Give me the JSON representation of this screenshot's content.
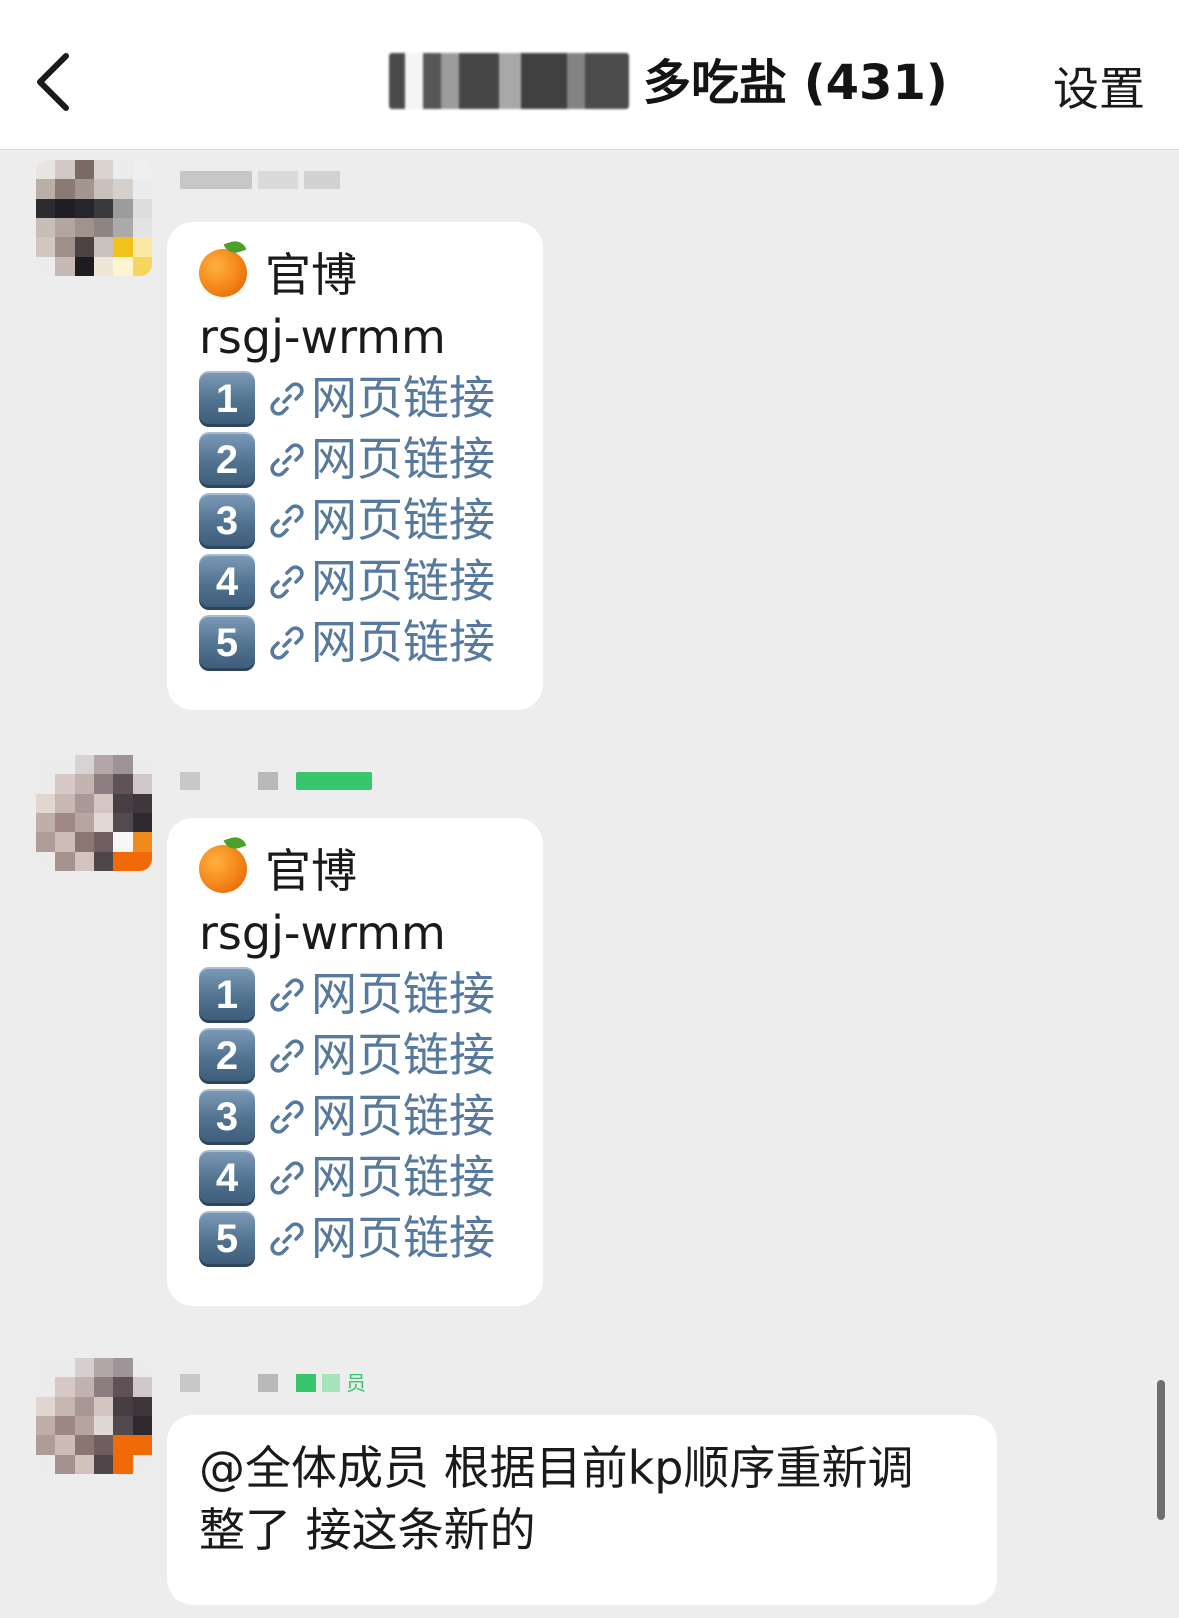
{
  "nav": {
    "title_suffix": "多吃盐 (431)",
    "settings_label": "设置",
    "back_icon": "chevron-left-icon"
  },
  "messages": [
    {
      "header": "官博",
      "id_line": "rsgj-wrmm",
      "links": [
        {
          "num": "1",
          "label": "网页链接"
        },
        {
          "num": "2",
          "label": "网页链接"
        },
        {
          "num": "3",
          "label": "网页链接"
        },
        {
          "num": "4",
          "label": "网页链接"
        },
        {
          "num": "5",
          "label": "网页链接"
        }
      ]
    },
    {
      "header": "官博",
      "id_line": "rsgj-wrmm",
      "links": [
        {
          "num": "1",
          "label": "网页链接"
        },
        {
          "num": "2",
          "label": "网页链接"
        },
        {
          "num": "3",
          "label": "网页链接"
        },
        {
          "num": "4",
          "label": "网页链接"
        },
        {
          "num": "5",
          "label": "网页链接"
        }
      ]
    },
    {
      "sender_badge": "员",
      "lines": [
        "@全体成员 根据目前kp顺序重新调",
        "整了 接这条新的"
      ]
    }
  ],
  "colors": {
    "link": "#57799d",
    "background": "#ededed",
    "bubble": "#ffffff"
  }
}
